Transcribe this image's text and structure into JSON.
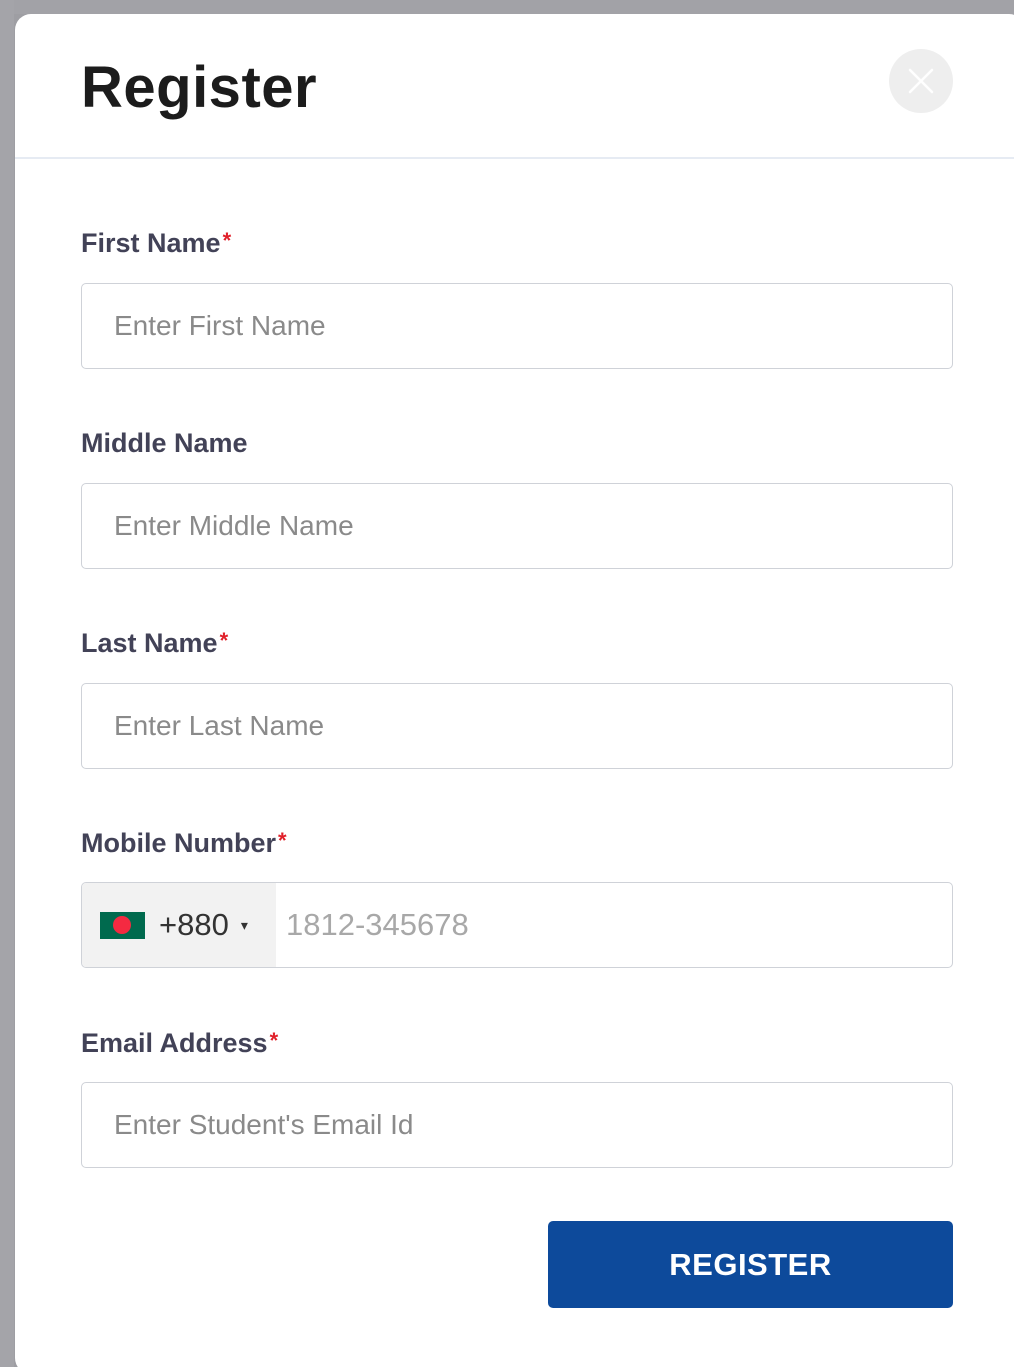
{
  "modal": {
    "title": "Register"
  },
  "form": {
    "first_name": {
      "label": "First Name",
      "required_mark": "*",
      "placeholder": "Enter First Name"
    },
    "middle_name": {
      "label": "Middle Name",
      "placeholder": "Enter Middle Name"
    },
    "last_name": {
      "label": "Last Name",
      "required_mark": "*",
      "placeholder": "Enter Last Name"
    },
    "mobile_number": {
      "label": "Mobile Number",
      "required_mark": "*",
      "country_flag": "bangladesh-flag-icon",
      "dial_code": "+880",
      "caret": "▾",
      "placeholder": "1812-345678"
    },
    "email": {
      "label": "Email Address",
      "required_mark": "*",
      "placeholder": "Enter Student's Email Id"
    },
    "submit_label": "REGISTER"
  },
  "colors": {
    "primary_button": "#0d4a9b",
    "required": "#e0202a",
    "label": "#424257"
  }
}
